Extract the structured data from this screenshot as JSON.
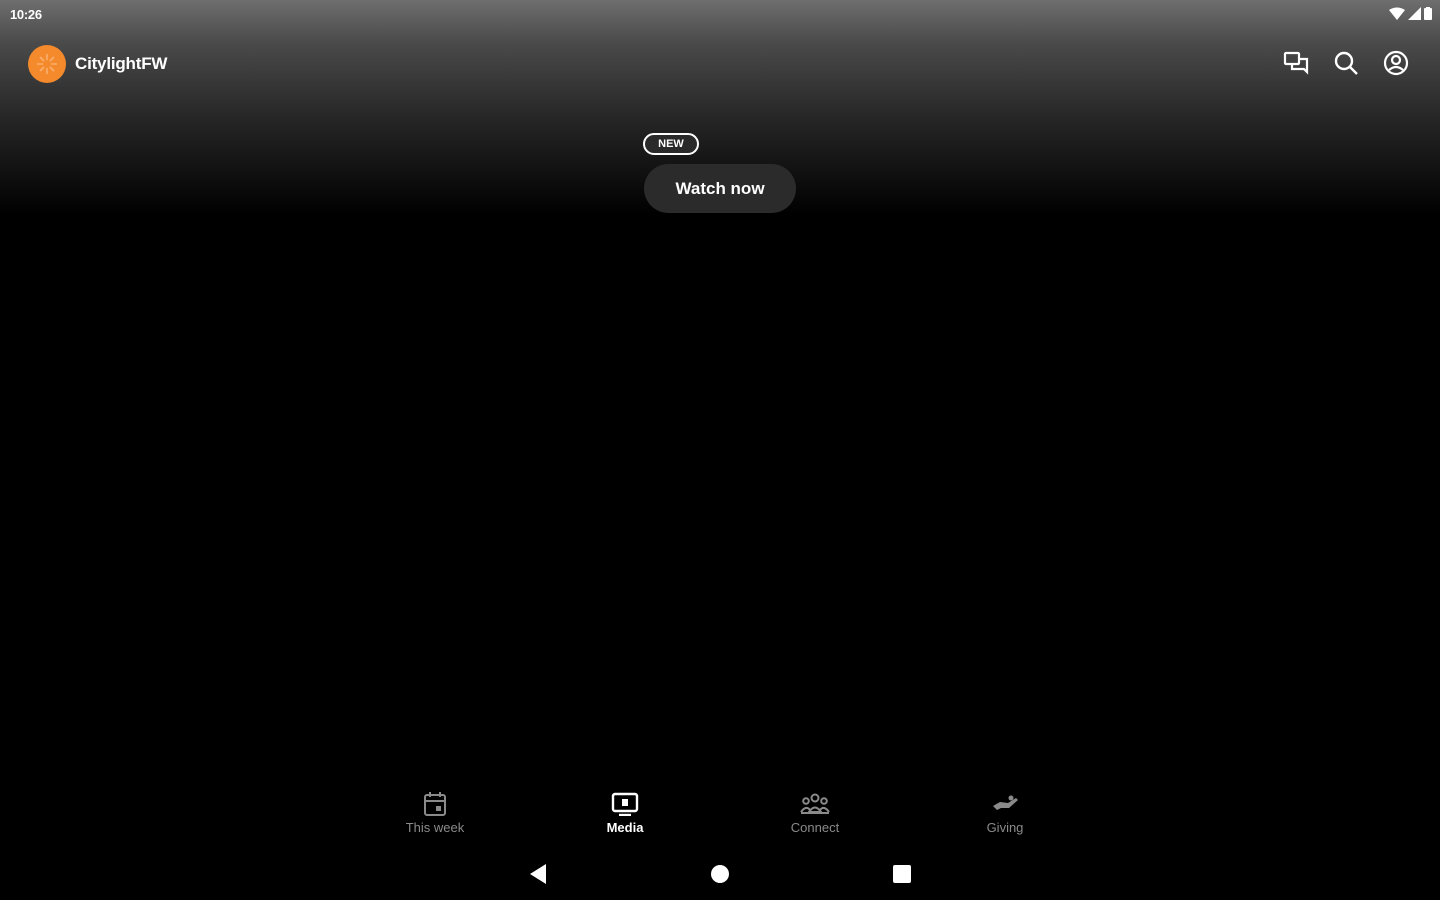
{
  "status_bar": {
    "time": "10:26",
    "icons": [
      "wifi-icon",
      "cell-signal-icon",
      "battery-icon"
    ]
  },
  "header": {
    "app_name": "CitylightFW",
    "logo_color": "#f58a2c",
    "actions": [
      {
        "icon": "chat-icon"
      },
      {
        "icon": "search-icon"
      },
      {
        "icon": "account-icon"
      }
    ]
  },
  "hero": {
    "title": "",
    "badge": "NEW",
    "cta_label": "Watch now"
  },
  "tabs": [
    {
      "label": "This week",
      "icon": "calendar-icon",
      "active": false
    },
    {
      "label": "Media",
      "icon": "media-icon",
      "active": true
    },
    {
      "label": "Connect",
      "icon": "people-icon",
      "active": false
    },
    {
      "label": "Giving",
      "icon": "giving-hand-icon",
      "active": false
    }
  ],
  "system_nav": [
    "back-icon",
    "home-icon",
    "recents-icon"
  ],
  "colors": {
    "background": "#000000",
    "accent": "#f58a2c",
    "inactive_tab": "#8a8a8a"
  }
}
